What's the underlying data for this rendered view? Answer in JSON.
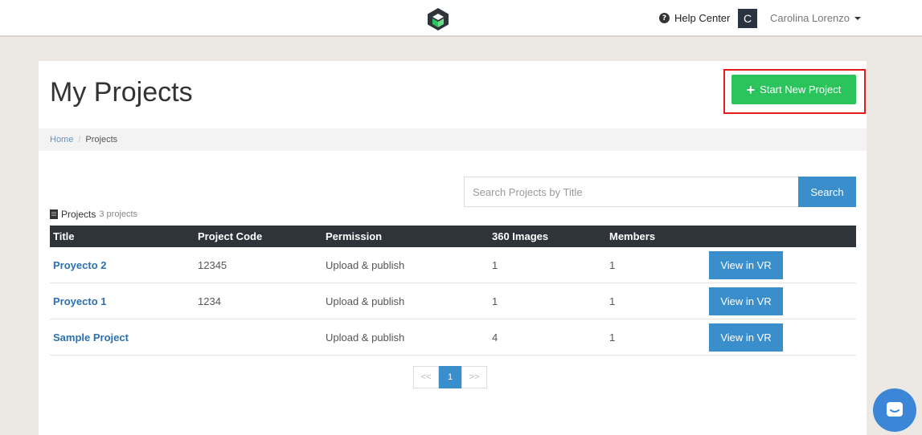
{
  "topnav": {
    "help_label": "Help Center",
    "help_icon": "question-circle-icon",
    "user_initial": "C",
    "user_name": "Carolina Lorenzo"
  },
  "page": {
    "title": "My Projects",
    "new_project_label": "Start New Project"
  },
  "breadcrumb": {
    "home": "Home",
    "separator": "/",
    "current": "Projects"
  },
  "search": {
    "placeholder": "Search Projects by Title",
    "button_label": "Search"
  },
  "projects": {
    "label": "Projects",
    "count": "3 projects",
    "columns": [
      "Title",
      "Project Code",
      "Permission",
      "360 Images",
      "Members",
      ""
    ],
    "rows": [
      {
        "title": "Proyecto 2",
        "code": "12345",
        "permission": "Upload & publish",
        "images": "1",
        "members": "1",
        "action": "View in VR"
      },
      {
        "title": "Proyecto 1",
        "code": "1234",
        "permission": "Upload & publish",
        "images": "1",
        "members": "1",
        "action": "View in VR"
      },
      {
        "title": "Sample Project",
        "code": "",
        "permission": "Upload & publish",
        "images": "4",
        "members": "1",
        "action": "View in VR"
      }
    ]
  },
  "pagination": {
    "prev": "<<",
    "current": "1",
    "next": ">>"
  },
  "colors": {
    "accent_blue": "#3a8ecb",
    "success_green": "#2bc35c",
    "highlight_red": "#e31b1b",
    "table_header": "#2f343a"
  }
}
